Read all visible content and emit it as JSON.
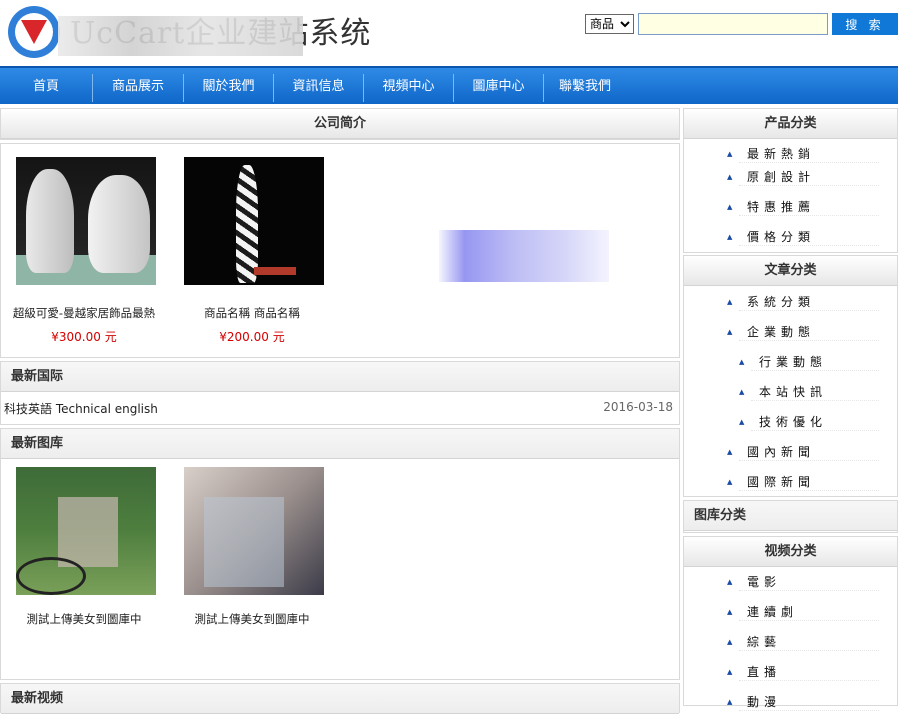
{
  "header": {
    "site_title": "UcCart企业建站系统",
    "search_option": "商品",
    "search_value": "",
    "search_button": "搜 索"
  },
  "nav": [
    "首頁",
    "商品展示",
    "關於我們",
    "資訊信息",
    "視頻中心",
    "圖庫中心",
    "聯繫我們"
  ],
  "main": {
    "company_intro": {
      "title": "公司简介",
      "products": [
        {
          "name": "超級可愛-曼越家居飾品最熱",
          "price": "¥300.00 元"
        },
        {
          "name": "商品名稱 商品名稱",
          "price": "¥200.00 元"
        }
      ]
    },
    "latest_international": {
      "title": "最新国际",
      "items": [
        {
          "title": "科技英語 Technical english",
          "date": "2016-03-18"
        }
      ]
    },
    "latest_gallery": {
      "title": "最新图库",
      "items": [
        {
          "caption": "測試上傳美女到圖庫中"
        },
        {
          "caption": "測試上傳美女到圖庫中"
        }
      ]
    },
    "latest_video": {
      "title": "最新视频"
    }
  },
  "sidebar": {
    "product_categories": {
      "title": "产品分类",
      "items": [
        "最新熱銷",
        "原創設計",
        "特惠推薦",
        "價格分類"
      ]
    },
    "article_categories": {
      "title": "文章分类",
      "items": [
        "系統分類",
        "企業動態",
        "行業動態",
        "本站快訊",
        "技術優化",
        "國內新聞",
        "國際新聞"
      ]
    },
    "gallery_categories": {
      "title": "图库分类"
    },
    "video_categories": {
      "title": "视频分类",
      "items": [
        "電影",
        "連續劇",
        "綜藝",
        "直播",
        "動漫"
      ]
    }
  },
  "colors": {
    "nav_bg": "#1874d5",
    "price": "#d40000",
    "button": "#1079d8"
  }
}
